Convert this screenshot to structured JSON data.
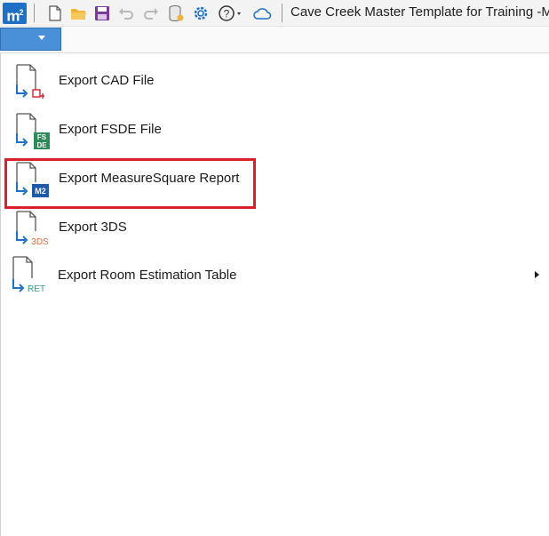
{
  "app": {
    "logo_text": "m",
    "logo_sup": "2",
    "title": "Cave Creek Master Template for Training -Me"
  },
  "quick_access": [
    {
      "name": "new-file-icon"
    },
    {
      "name": "open-folder-icon"
    },
    {
      "name": "save-icon"
    },
    {
      "name": "undo-icon"
    },
    {
      "name": "redo-icon"
    },
    {
      "name": "database-icon"
    },
    {
      "name": "gear-icon"
    },
    {
      "name": "help-icon"
    },
    {
      "name": "cloud-icon"
    }
  ],
  "menu": {
    "items": [
      {
        "label": "Export CAD File",
        "icon": "export-cad-icon",
        "badge": ""
      },
      {
        "label": "Export FSDE File",
        "icon": "export-fsde-icon",
        "badge": "FS DE"
      },
      {
        "label": "Export MeasureSquare Report",
        "icon": "export-m2-icon",
        "badge": "M2"
      },
      {
        "label": "Export 3DS",
        "icon": "export-3ds-icon",
        "badge": "3DS"
      },
      {
        "label": "Export Room Estimation Table",
        "icon": "export-ret-icon",
        "badge": "RET",
        "has_submenu": true
      }
    ],
    "highlighted": "Export MeasureSquare Report"
  },
  "colors": {
    "accent": "#4a90d9",
    "highlight_border": "#d9202b",
    "fsde_green": "#2e8b57",
    "m2_blue": "#1e5aa8",
    "three_ds_orange": "#e06a3a",
    "ret_teal": "#2e9c8a"
  }
}
